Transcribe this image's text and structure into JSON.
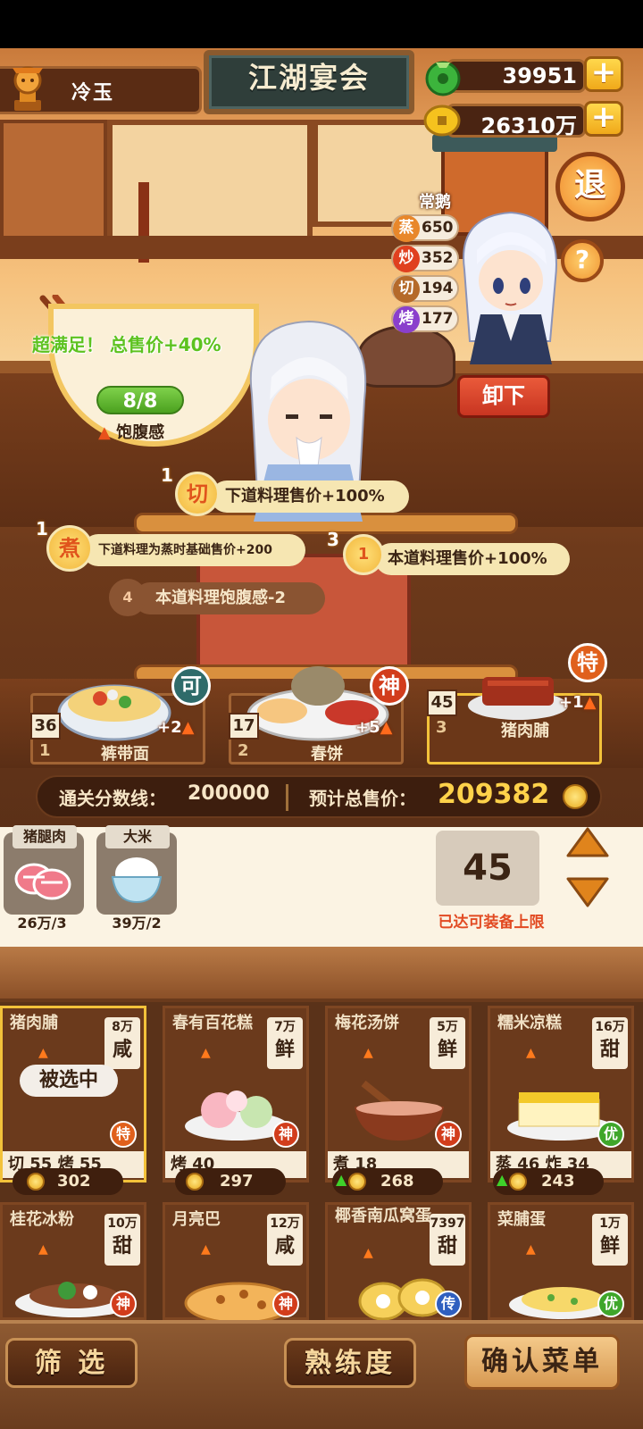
{
  "header": {
    "player_name": "冷玉",
    "title": "江湖宴会",
    "jade": "39951",
    "coins": "26310万",
    "exit_label": "退",
    "help_label": "?"
  },
  "chef": {
    "name": "常鹅",
    "skills": [
      {
        "label": "蒸",
        "value": "650",
        "color": "#e8872a"
      },
      {
        "label": "炒",
        "value": "352",
        "color": "#e0401f"
      },
      {
        "label": "切",
        "value": "194",
        "color": "#b56a2a"
      },
      {
        "label": "烤",
        "value": "177",
        "color": "#8a3fcc"
      }
    ],
    "unload_label": "卸下"
  },
  "satisfaction": {
    "text": "超满足！ 总售价+40%",
    "fullness": "8/8",
    "fullness_label": "饱腹感"
  },
  "effects": [
    {
      "num": "1",
      "tag": "切",
      "text": "下道料理售价+100%"
    },
    {
      "num": "1",
      "tag": "煮",
      "text": "下道料理为蒸时基础售价+200"
    },
    {
      "num": "3",
      "tag": "1",
      "text": "本道料理售价+100%"
    },
    {
      "num": "",
      "tag": "4",
      "text": "本道料理饱腹感-2"
    }
  ],
  "dishes": [
    {
      "slot": "1",
      "name": "裤带面",
      "count": "36",
      "bonus": "+2",
      "grade": "可",
      "grade_color": "#2f6b6a"
    },
    {
      "slot": "2",
      "name": "春饼",
      "count": "17",
      "bonus": "+5",
      "grade": "神",
      "grade_color": "#d23d1c"
    },
    {
      "slot": "3",
      "name": "猪肉脯",
      "count": "45",
      "bonus": "+1",
      "grade": "特",
      "grade_color": "#e0601c"
    }
  ],
  "score": {
    "line_label": "通关分数线：",
    "line_value": "200000",
    "est_label": "预计总售价：",
    "est_value": "209382"
  },
  "ingredients": [
    {
      "name": "猪腿肉",
      "qty": "26万/3"
    },
    {
      "name": "大米",
      "qty": "39万/2"
    }
  ],
  "equip": {
    "level": "45",
    "note": "已达可装备上限"
  },
  "recipes": [
    {
      "name": "猪肉脯",
      "price": "8万",
      "flavor": "咸",
      "skills": "切 55  烤 55",
      "grade": "特",
      "grade_color": "#e0601c",
      "cost": "302",
      "up": false
    },
    {
      "name": "春有百花糕",
      "price": "7万",
      "flavor": "鲜",
      "skills": "烤 40",
      "grade": "神",
      "grade_color": "#d23d1c",
      "cost": "297",
      "up": false
    },
    {
      "name": "梅花汤饼",
      "price": "5万",
      "flavor": "鲜",
      "skills": "煮 18",
      "grade": "神",
      "grade_color": "#d23d1c",
      "cost": "268",
      "up": true
    },
    {
      "name": "糯米凉糕",
      "price": "16万",
      "flavor": "甜",
      "skills": "蒸 46  炸 34",
      "grade": "优",
      "grade_color": "#3fa62a",
      "cost": "243",
      "up": true
    },
    {
      "name": "桂花冰粉",
      "price": "10万",
      "flavor": "甜",
      "skills": "",
      "grade": "神",
      "grade_color": "#d23d1c",
      "cost": "",
      "up": false
    },
    {
      "name": "月亮巴",
      "price": "12万",
      "flavor": "咸",
      "skills": "",
      "grade": "神",
      "grade_color": "#d23d1c",
      "cost": "",
      "up": false
    },
    {
      "name": "椰香南瓜窝蛋",
      "price": "7397",
      "flavor": "甜",
      "skills": "",
      "grade": "传",
      "grade_color": "#2f5fbf",
      "cost": "",
      "up": false
    },
    {
      "name": "菜脯蛋",
      "price": "1万",
      "flavor": "鲜",
      "skills": "",
      "grade": "优",
      "grade_color": "#3fa62a",
      "cost": "",
      "up": false
    }
  ],
  "selected_label": "被选中",
  "buttons": {
    "filter": "筛 选",
    "proficiency": "熟练度",
    "confirm": "确认菜单"
  }
}
